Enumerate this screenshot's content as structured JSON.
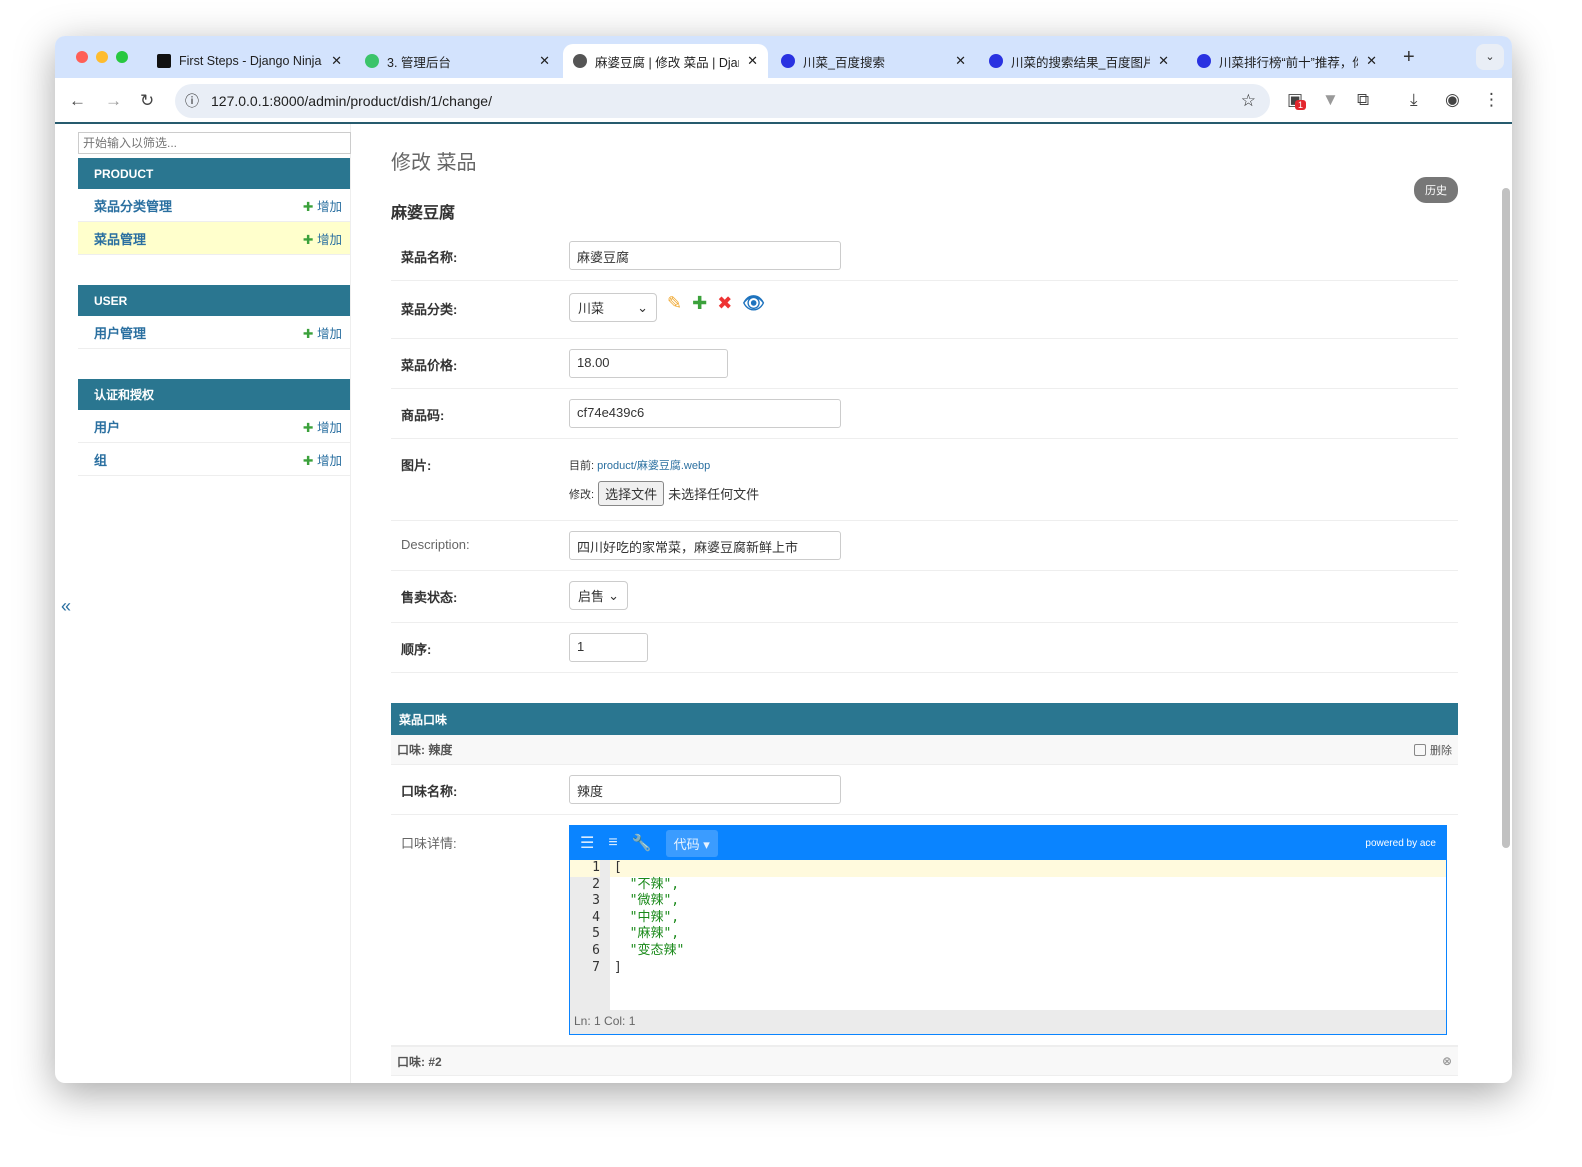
{
  "browser": {
    "tabs": [
      {
        "title": "First Steps - Django Ninja",
        "active": false
      },
      {
        "title": "3. 管理后台",
        "active": false
      },
      {
        "title": "麻婆豆腐 | 修改 菜品 | Django",
        "active": true
      },
      {
        "title": "川菜_百度搜索",
        "active": false
      },
      {
        "title": "川菜的搜索结果_百度图片",
        "active": false
      },
      {
        "title": "川菜排行榜“前十”推荐，你",
        "active": false
      }
    ],
    "new_tab": "+",
    "url": "127.0.0.1:8000/admin/product/dish/1/change/",
    "ext_badge": "1"
  },
  "sidebar": {
    "filter_placeholder": "开始输入以筛选...",
    "add_label": "增加",
    "modules": [
      {
        "title": "PRODUCT",
        "items": [
          {
            "label": "菜品分类管理"
          },
          {
            "label": "菜品管理",
            "selected": true
          }
        ]
      },
      {
        "title": "USER",
        "items": [
          {
            "label": "用户管理"
          }
        ]
      },
      {
        "title": "认证和授权",
        "items": [
          {
            "label": "用户"
          },
          {
            "label": "组"
          }
        ]
      }
    ],
    "collapse": "«"
  },
  "main": {
    "page_title": "修改 菜品",
    "object_title": "麻婆豆腐",
    "history": "历史",
    "fields": {
      "name": {
        "label": "菜品名称:",
        "value": "麻婆豆腐"
      },
      "category": {
        "label": "菜品分类:",
        "value": "川菜"
      },
      "price": {
        "label": "菜品价格:",
        "value": "18.00"
      },
      "code": {
        "label": "商品码:",
        "value": "cf74e439c6"
      },
      "image": {
        "label": "图片:",
        "current_label": "目前:",
        "current_value": "product/麻婆豆腐.webp",
        "change_label": "修改:",
        "choose_button": "选择文件",
        "no_file": "未选择任何文件"
      },
      "description": {
        "label": "Description:",
        "value": "四川好吃的家常菜，麻婆豆腐新鲜上市"
      },
      "status": {
        "label": "售卖状态:",
        "value": "启售"
      },
      "order": {
        "label": "顺序:",
        "value": "1"
      }
    },
    "inline": {
      "title": "菜品口味",
      "item1_title": "口味: 辣度",
      "delete_label": "删除",
      "flavor_name_label": "口味名称:",
      "flavor_name_value": "辣度",
      "flavor_detail_label": "口味详情:",
      "editor": {
        "mode_button": "代码",
        "powered": "powered by ace",
        "lines": [
          "[",
          "  \"不辣\",",
          "  \"微辣\",",
          "  \"中辣\",",
          "  \"麻辣\",",
          "  \"变态辣\"",
          "]"
        ],
        "line_numbers": [
          "1",
          "2",
          "3",
          "4",
          "5",
          "6",
          "7"
        ],
        "status": "Ln: 1    Col: 1"
      },
      "item2_title": "口味: #2"
    }
  }
}
